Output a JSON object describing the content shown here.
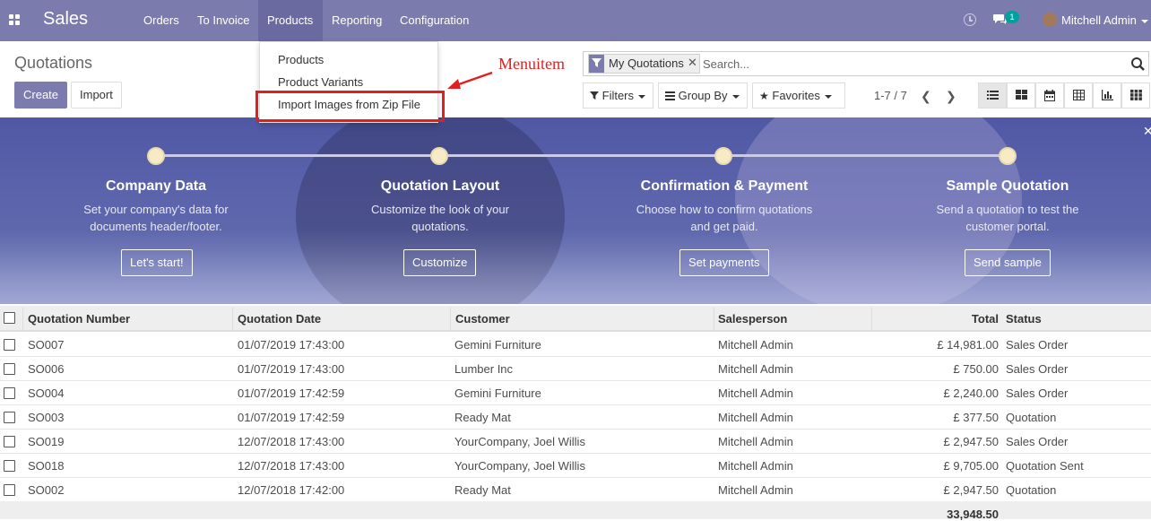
{
  "navbar": {
    "brand": "Sales",
    "menu": [
      "Orders",
      "To Invoice",
      "Products",
      "Reporting",
      "Configuration"
    ],
    "active_menu": "Products",
    "chat_badge": "1",
    "user": "Mitchell Admin",
    "bg_color": "#7c7bad"
  },
  "control_panel": {
    "breadcrumb": "Quotations",
    "create_label": "Create",
    "import_label": "Import",
    "search": {
      "facet": "My Quotations",
      "placeholder": "Search..."
    },
    "filters_label": "Filters",
    "groupby_label": "Group By",
    "favorites_label": "Favorites",
    "pager": "1-7 / 7"
  },
  "dropdown": {
    "items": [
      "Products",
      "Product Variants",
      "Import Images from Zip File"
    ]
  },
  "annotation": {
    "label": "Menuitem",
    "color": "#e02020"
  },
  "banner": {
    "steps": [
      {
        "title": "Company Data",
        "desc_line1": "Set your company's data for",
        "desc_line2": "documents header/footer.",
        "button": "Let's start!"
      },
      {
        "title": "Quotation Layout",
        "desc_line1": "Customize the look of your",
        "desc_line2": "quotations.",
        "button": "Customize"
      },
      {
        "title": "Confirmation & Payment",
        "desc_line1": "Choose how to confirm quotations",
        "desc_line2": "and get paid.",
        "button": "Set payments"
      },
      {
        "title": "Sample Quotation",
        "desc_line1": "Send a quotation to test the",
        "desc_line2": "customer portal.",
        "button": "Send sample"
      }
    ]
  },
  "table": {
    "columns": [
      "Quotation Number",
      "Quotation Date",
      "Customer",
      "Salesperson",
      "Total",
      "Status"
    ],
    "rows": [
      {
        "number": "SO007",
        "date": "01/07/2019 17:43:00",
        "customer": "Gemini Furniture",
        "salesperson": "Mitchell Admin",
        "total": "£ 14,981.00",
        "status": "Sales Order"
      },
      {
        "number": "SO006",
        "date": "01/07/2019 17:43:00",
        "customer": "Lumber Inc",
        "salesperson": "Mitchell Admin",
        "total": "£ 750.00",
        "status": "Sales Order"
      },
      {
        "number": "SO004",
        "date": "01/07/2019 17:42:59",
        "customer": "Gemini Furniture",
        "salesperson": "Mitchell Admin",
        "total": "£ 2,240.00",
        "status": "Sales Order"
      },
      {
        "number": "SO003",
        "date": "01/07/2019 17:42:59",
        "customer": "Ready Mat",
        "salesperson": "Mitchell Admin",
        "total": "£ 377.50",
        "status": "Quotation"
      },
      {
        "number": "SO019",
        "date": "12/07/2018 17:43:00",
        "customer": "YourCompany, Joel Willis",
        "salesperson": "Mitchell Admin",
        "total": "£ 2,947.50",
        "status": "Sales Order"
      },
      {
        "number": "SO018",
        "date": "12/07/2018 17:43:00",
        "customer": "YourCompany, Joel Willis",
        "salesperson": "Mitchell Admin",
        "total": "£ 9,705.00",
        "status": "Quotation Sent"
      },
      {
        "number": "SO002",
        "date": "12/07/2018 17:42:00",
        "customer": "Ready Mat",
        "salesperson": "Mitchell Admin",
        "total": "£ 2,947.50",
        "status": "Quotation"
      }
    ],
    "sum_total": "33,948.50"
  }
}
